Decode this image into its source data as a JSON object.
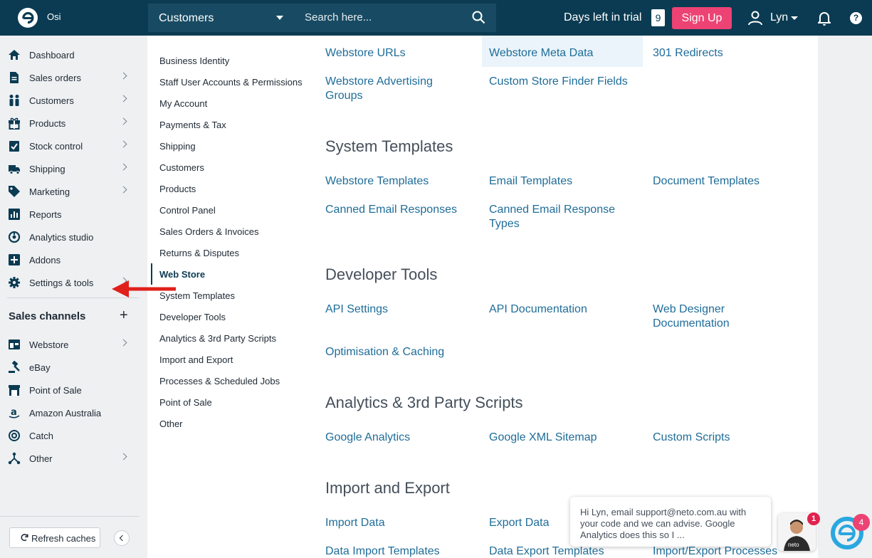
{
  "topbar": {
    "store_name": "Osi",
    "selector_value": "Customers",
    "search_placeholder": "Search here...",
    "trial_label": "Days left in trial",
    "trial_days": "9",
    "signup_label": "Sign Up",
    "user_name": "Lyn",
    "help_label": "?"
  },
  "sidebar": {
    "items": [
      {
        "label": "Dashboard",
        "icon": "home-icon",
        "chevron": false
      },
      {
        "label": "Sales orders",
        "icon": "document-icon",
        "chevron": true
      },
      {
        "label": "Customers",
        "icon": "people-icon",
        "chevron": true
      },
      {
        "label": "Products",
        "icon": "gift-icon",
        "chevron": true
      },
      {
        "label": "Stock control",
        "icon": "checklist-icon",
        "chevron": true
      },
      {
        "label": "Shipping",
        "icon": "truck-icon",
        "chevron": true
      },
      {
        "label": "Marketing",
        "icon": "tag-icon",
        "chevron": true
      },
      {
        "label": "Reports",
        "icon": "bar-chart-icon",
        "chevron": false
      },
      {
        "label": "Analytics studio",
        "icon": "analytics-icon",
        "chevron": false
      },
      {
        "label": "Addons",
        "icon": "plus-square-icon",
        "chevron": false
      },
      {
        "label": "Settings & tools",
        "icon": "gear-icon",
        "chevron": true
      }
    ],
    "sales_channels_heading": "Sales channels",
    "add_label": "+",
    "channels": [
      {
        "label": "Webstore",
        "icon": "webstore-icon",
        "chevron": true
      },
      {
        "label": "eBay",
        "icon": "gavel-icon",
        "chevron": false
      },
      {
        "label": "Point of Sale",
        "icon": "store-icon",
        "chevron": false
      },
      {
        "label": "Amazon Australia",
        "icon": "amazon-icon",
        "chevron": false
      },
      {
        "label": "Catch",
        "icon": "catch-icon",
        "chevron": false
      },
      {
        "label": "Other",
        "icon": "network-icon",
        "chevron": true
      }
    ],
    "refresh_label": "Refresh caches"
  },
  "settings_nav": [
    "Business Identity",
    "Staff User Accounts & Permissions",
    "My Account",
    "Payments & Tax",
    "Shipping",
    "Customers",
    "Products",
    "Control Panel",
    "Sales Orders & Invoices",
    "Returns & Disputes",
    "Web Store",
    "System Templates",
    "Developer Tools",
    "Analytics & 3rd Party Scripts",
    "Import and Export",
    "Processes & Scheduled Jobs",
    "Point of Sale",
    "Other"
  ],
  "settings_nav_active": "Web Store",
  "sections": {
    "webstore": {
      "links": [
        "Webstore URLs",
        "Webstore Meta Data",
        "301 Redirects",
        "Webstore Advertising Groups",
        "Custom Store Finder Fields"
      ]
    },
    "system_templates": {
      "title": "System Templates",
      "links": [
        "Webstore Templates",
        "Email Templates",
        "Document Templates",
        "Canned Email Responses",
        "Canned Email Response Types"
      ]
    },
    "developer_tools": {
      "title": "Developer Tools",
      "links": [
        "API Settings",
        "API Documentation",
        "Web Designer Documentation",
        "Optimisation & Caching"
      ]
    },
    "analytics": {
      "title": "Analytics & 3rd Party Scripts",
      "links": [
        "Google Analytics",
        "Google XML Sitemap",
        "Custom Scripts"
      ]
    },
    "import_export": {
      "title": "Import and Export",
      "links": [
        "Import Data",
        "Export Data",
        "Data Import Templates",
        "Data Export Templates",
        "Import/Export Processes"
      ]
    }
  },
  "chat": {
    "message": "Hi Lyn, email support@neto.com.au with your code and we can advise. Google Analytics does this so I ...",
    "badge": "1",
    "neto_badge": "4"
  },
  "colors": {
    "topbar": "#0b3b52",
    "accent_pink": "#ec4374",
    "link": "#1f6d99",
    "annotation_arrow": "#e0201b"
  }
}
